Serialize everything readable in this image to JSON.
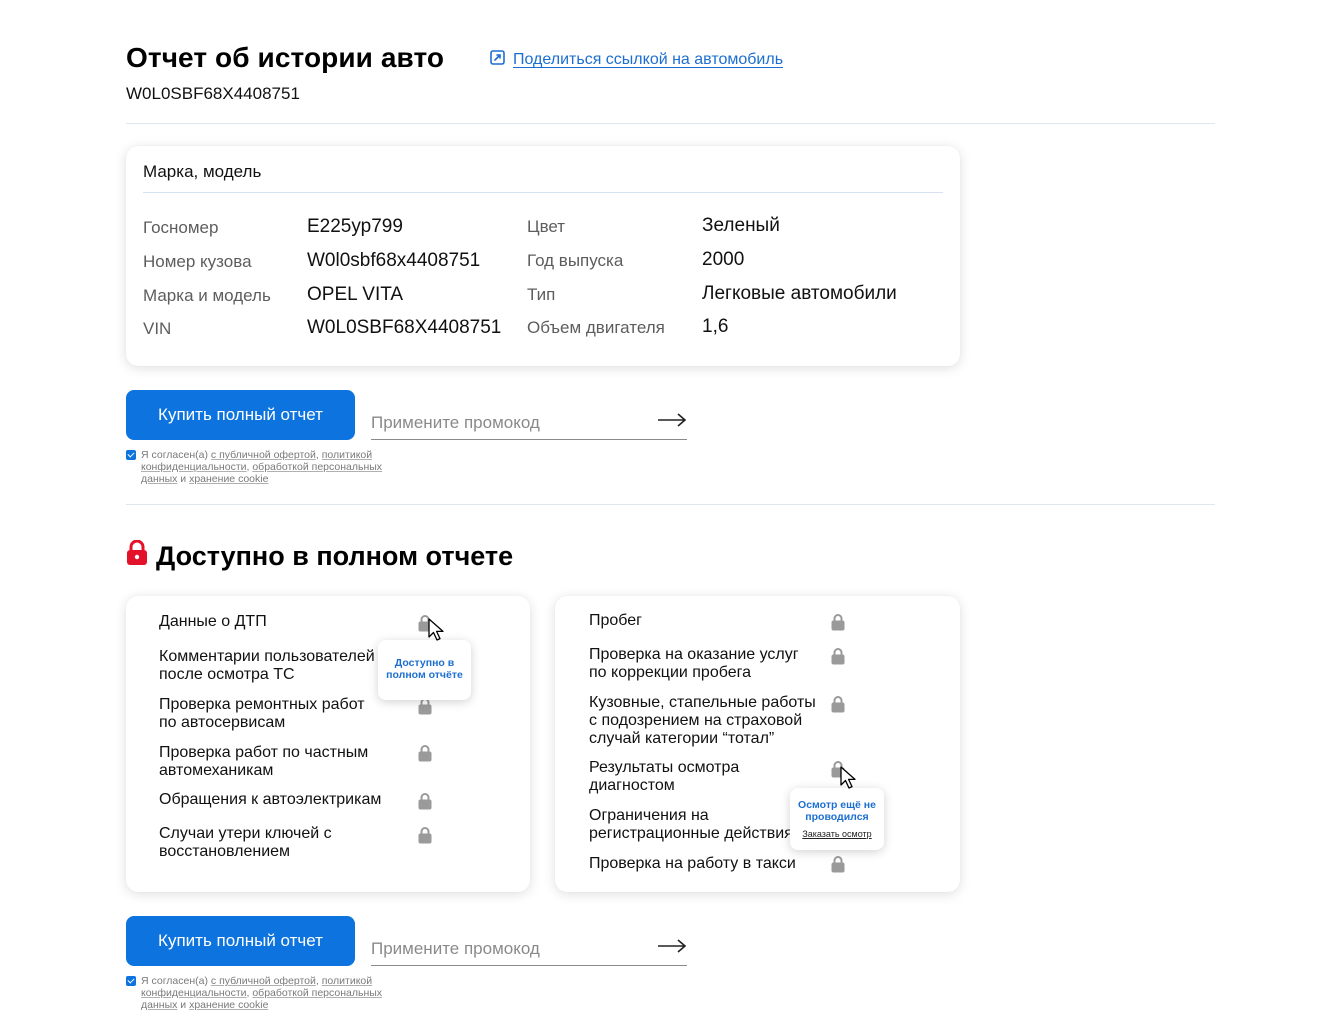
{
  "header": {
    "title": "Отчет об истории авто",
    "vin": "W0L0SBF68X4408751",
    "share_label": "Поделиться ссылкой на автомобиль"
  },
  "info": {
    "heading": "Марка, модель",
    "left": [
      {
        "label": "Госномер",
        "value": "Е225ур799"
      },
      {
        "label": "Номер кузова",
        "value": "W0l0sbf68x4408751"
      },
      {
        "label": "Марка и модель",
        "value": "OPEL VITA"
      },
      {
        "label": "VIN",
        "value": "W0L0SBF68X4408751"
      }
    ],
    "right": [
      {
        "label": "Цвет",
        "value": "Зеленый"
      },
      {
        "label": "Год выпуска",
        "value": "2000"
      },
      {
        "label": "Тип",
        "value": "Легковые автомобили"
      },
      {
        "label": "Объем двигателя",
        "value": "1,6"
      }
    ]
  },
  "purchase": {
    "button": "Купить полный отчет",
    "promo_placeholder": "Примените промокод",
    "consent": {
      "part1": "Я согласен(а) ",
      "link1": "с публичной офертой",
      "part2": ", ",
      "link2": "политикой конфиденциальности",
      "part3": ", ",
      "link3": "обработкой персональных данных",
      "part4": " и ",
      "link4": "хранение cookie"
    }
  },
  "locked": {
    "title": "Доступно в полном отчете",
    "left_items": [
      "Данные о ДТП",
      "Комментарии пользователей после осмотра ТС",
      "Проверка ремонтных работ по автосервисам",
      "Проверка работ по частным автомеханикам",
      "Обращения к автоэлектрикам",
      "Случаи утери ключей с восстановлением"
    ],
    "right_items": [
      "Пробег",
      "Проверка на оказание услуг по коррекции пробега",
      "Кузовные, стапельные работы с подозрением на страховой случай категории “тотал”",
      "Результаты осмотра диагностом",
      "Ограничения на регистрационные действия",
      "Проверка на работу в такси"
    ],
    "tooltip_left": "Доступно в полном отчёте",
    "tooltip_right": "Осмотр ещё не проводился",
    "tooltip_right_link": "Заказать осмотр"
  },
  "colors": {
    "accent": "#0c73df",
    "link": "#1c6fd1",
    "lock_red": "#e4112b",
    "lock_gray": "#9a9a9a"
  }
}
